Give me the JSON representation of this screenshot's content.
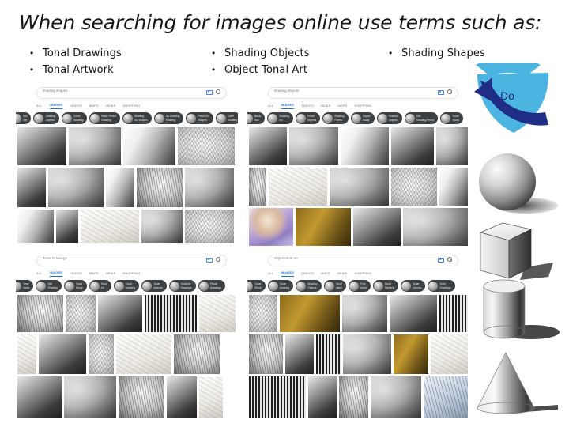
{
  "slide": {
    "title": "When searching for images online use terms such as:"
  },
  "bullet_columns": [
    {
      "items": [
        "Tonal Drawings",
        "Tonal Artwork"
      ]
    },
    {
      "items": [
        "Shading Objects",
        "Object Tonal Art"
      ]
    },
    {
      "items": [
        "Shading Shapes"
      ]
    }
  ],
  "bullet_marker": "•",
  "panels": [
    {
      "name": "shading-shapes-search",
      "query": "shading shapes",
      "tabs": [
        "ALL",
        "IMAGES",
        "VIDEOS",
        "MAPS",
        "NEWS",
        "SHOPPING"
      ],
      "active_tab": "IMAGES",
      "chips": [
        {
          "line1": "Still",
          "line2": "Life"
        },
        {
          "line1": "Shading",
          "line2": "Objects"
        },
        {
          "line1": "Circle",
          "line2": "Shading"
        },
        {
          "line1": "Basic Pencil",
          "line2": "Shading"
        },
        {
          "line1": "Shading",
          "line2": "3D Shapes"
        },
        {
          "line1": "3D Drawing",
          "line2": "Shading"
        },
        {
          "line1": "Pencil Art",
          "line2": "Shapes"
        },
        {
          "line1": "Cube",
          "line2": "Shading"
        }
      ]
    },
    {
      "name": "shading-objects-search",
      "query": "shading objects",
      "tabs": [
        "ALL",
        "IMAGES",
        "VIDEOS",
        "NEWS",
        "MAPS",
        "SHOPPING"
      ],
      "active_tab": "IMAGES",
      "chips": [
        {
          "line1": "Basic",
          "line2": "Still"
        },
        {
          "line1": "Shading",
          "line2": "Art"
        },
        {
          "line1": "Pencil",
          "line2": "Objects"
        },
        {
          "line1": "Shading",
          "line2": "Forms"
        },
        {
          "line1": "Object",
          "line2": "Study"
        },
        {
          "line1": "Shadow",
          "line2": "Objects"
        },
        {
          "line1": "Still",
          "line2": "Shading Pencil"
        },
        {
          "line1": "Tonal",
          "line2": "Study"
        }
      ]
    },
    {
      "name": "tonal-drawings-search",
      "query": "Tonal Drawings",
      "tabs": [
        "ALL",
        "IMAGES",
        "VIDEOS",
        "MAPS",
        "NEWS",
        "SHOPPING"
      ],
      "active_tab": "IMAGES",
      "chips": [
        {
          "line1": "Tone",
          "line2": "Value"
        },
        {
          "line1": "Still",
          "line2": "Shading"
        },
        {
          "line1": "Tonal",
          "line2": "Study"
        },
        {
          "line1": "Tonal",
          "line2": "Art"
        },
        {
          "line1": "Tonal",
          "line2": "Drawing"
        },
        {
          "line1": "Tonal",
          "line2": "Artwork"
        },
        {
          "line1": "Graphite",
          "line2": "Drawings"
        },
        {
          "line1": "Pencil",
          "line2": "Drawings"
        }
      ]
    },
    {
      "name": "object-tonal-art-search",
      "query": "object tonal art",
      "tabs": [
        "ALL",
        "IMAGES",
        "VIDEOS",
        "MAPS",
        "NEWS",
        "SHOPPING"
      ],
      "active_tab": "IMAGES",
      "chips": [
        {
          "line1": "Tonal",
          "line2": "Study"
        },
        {
          "line1": "Tonal",
          "line2": "Drawing"
        },
        {
          "line1": "Shading",
          "line2": "Objects"
        },
        {
          "line1": "Tonal",
          "line2": "Value"
        },
        {
          "line1": "Fine",
          "line2": "Artist"
        },
        {
          "line1": "Tonal",
          "line2": "Painting"
        },
        {
          "line1": "Tonal",
          "line2": "Canvas"
        },
        {
          "line1": "Tone",
          "line2": "Drawings"
        }
      ]
    }
  ],
  "callout": {
    "label": "Do",
    "fan_color": "#4BB4E0",
    "arrow_color": "#1F2D86"
  },
  "figures": [
    {
      "name": "shaded-sphere",
      "label": "sphere"
    },
    {
      "name": "shaded-cube",
      "label": "cube"
    },
    {
      "name": "shaded-cylinder",
      "label": "cylinder"
    },
    {
      "name": "shaded-cone",
      "label": "cone"
    }
  ]
}
